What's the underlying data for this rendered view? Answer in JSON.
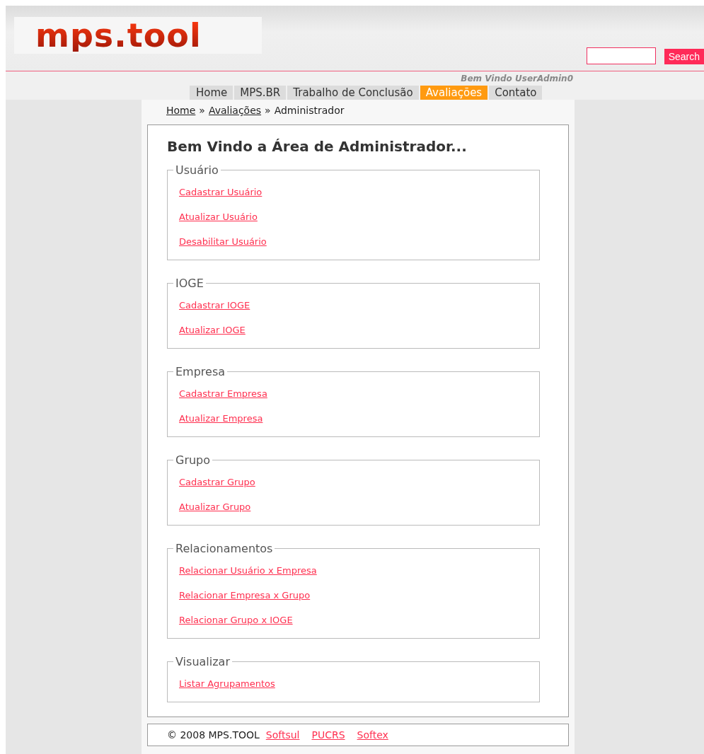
{
  "header": {
    "logo": "mps.tool",
    "search": {
      "button": "Search"
    },
    "welcome": "Bem Vindo UserAdmin0"
  },
  "nav": [
    {
      "label": "Home",
      "selected": false
    },
    {
      "label": "MPS.BR",
      "selected": false
    },
    {
      "label": "Trabalho de Conclusão",
      "selected": false
    },
    {
      "label": "Avaliações",
      "selected": true
    },
    {
      "label": "Contato",
      "selected": false
    }
  ],
  "breadcrumb": [
    {
      "label": "Home",
      "link": true
    },
    {
      "label": "Avaliações",
      "link": true
    },
    {
      "label": "Administrador",
      "link": false
    }
  ],
  "breadcrumb_separator": "»",
  "title": "Bem Vindo a Área de Administrador...",
  "sections": [
    {
      "legend": "Usuário",
      "links": [
        "Cadastrar Usuário",
        "Atualizar Usuário",
        "Desabilitar Usuário"
      ]
    },
    {
      "legend": "IOGE",
      "links": [
        "Cadastrar IOGE",
        "Atualizar IOGE"
      ]
    },
    {
      "legend": "Empresa",
      "links": [
        "Cadastrar Empresa",
        "Atualizar Empresa"
      ]
    },
    {
      "legend": "Grupo",
      "links": [
        "Cadastrar Grupo",
        "Atualizar Grupo"
      ]
    },
    {
      "legend": "Relacionamentos",
      "links": [
        "Relacionar Usuário x Empresa",
        "Relacionar Empresa x Grupo",
        "Relacionar Grupo x IOGE"
      ]
    },
    {
      "legend": "Visualizar",
      "links": [
        "Listar Agrupamentos"
      ]
    }
  ],
  "footer": {
    "copyright": "© 2008 MPS.TOOL",
    "links": [
      "Softsul",
      "PUCRS",
      "Softex"
    ]
  }
}
